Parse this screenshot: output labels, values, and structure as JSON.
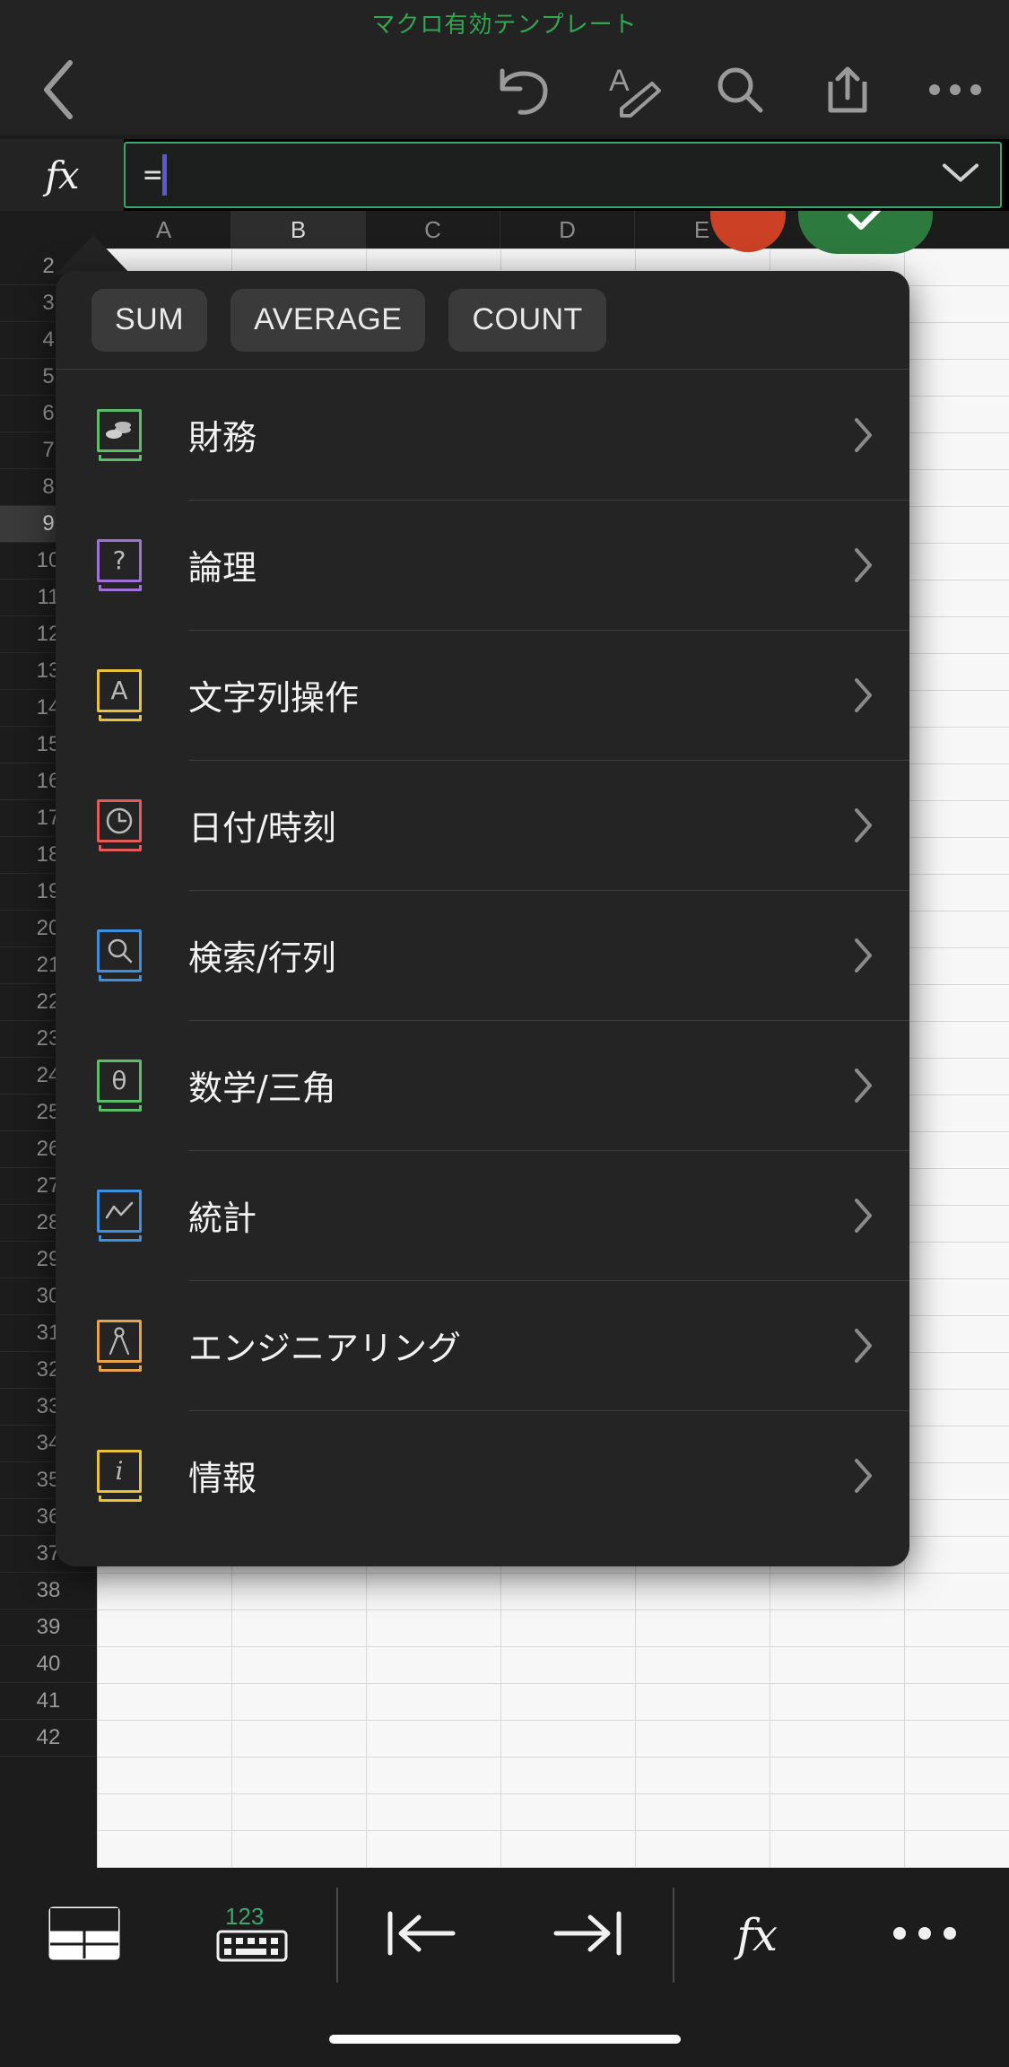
{
  "titlebar": {
    "doc_title": "マクロ有効テンプレート",
    "title_color": "#2fa84f"
  },
  "navbar": {
    "back_icon": "chevron-left-icon",
    "buttons": [
      {
        "name": "undo-button",
        "icon": "undo-icon"
      },
      {
        "name": "edit-text-button",
        "icon": "text-pen-icon"
      },
      {
        "name": "search-button",
        "icon": "search-icon"
      },
      {
        "name": "share-button",
        "icon": "share-icon"
      },
      {
        "name": "more-button",
        "icon": "ellipsis-icon"
      }
    ]
  },
  "formula_bar": {
    "fx_label": "fx",
    "value": "=",
    "placeholder": "",
    "expand_icon": "chevron-down-icon",
    "border_color": "#3aa76d",
    "caret_color": "#5a5ad6"
  },
  "sheet": {
    "columns": [
      "A",
      "B",
      "C",
      "D",
      "E"
    ],
    "selected_column": "B",
    "rows": [
      "2",
      "3",
      "4",
      "5",
      "6",
      "7",
      "8",
      "9",
      "10",
      "11",
      "12",
      "13",
      "14",
      "15",
      "16",
      "17",
      "18",
      "19",
      "20",
      "21",
      "22",
      "23",
      "24",
      "25",
      "26",
      "27",
      "28",
      "29",
      "30",
      "31",
      "32",
      "33",
      "34",
      "35",
      "36",
      "37",
      "38",
      "39",
      "40",
      "41",
      "42"
    ],
    "selected_row": "9",
    "cancel_button_color": "#cc4125",
    "confirm_button_color": "#2d7a3f",
    "confirm_icon": "checkmark-icon"
  },
  "function_picker": {
    "quick_functions": [
      "SUM",
      "AVERAGE",
      "COUNT"
    ],
    "categories": [
      {
        "label": "財務",
        "icon": "book-coins-icon",
        "color": "#5bbf6a",
        "symbol": "coins",
        "chevron": "chevron-right-icon"
      },
      {
        "label": "論理",
        "icon": "book-question-icon",
        "color": "#a071d6",
        "symbol": "?",
        "chevron": "chevron-right-icon"
      },
      {
        "label": "文字列操作",
        "icon": "book-letter-a-icon",
        "color": "#e8c23c",
        "symbol": "A",
        "chevron": "chevron-right-icon"
      },
      {
        "label": "日付/時刻",
        "icon": "book-clock-icon",
        "color": "#e35b5b",
        "symbol": "clock",
        "chevron": "chevron-right-icon"
      },
      {
        "label": "検索/行列",
        "icon": "book-search-icon",
        "color": "#3d8fe0",
        "symbol": "search",
        "chevron": "chevron-right-icon"
      },
      {
        "label": "数学/三角",
        "icon": "book-theta-icon",
        "color": "#5bbf6a",
        "symbol": "θ",
        "chevron": "chevron-right-icon"
      },
      {
        "label": "統計",
        "icon": "book-chart-icon",
        "color": "#3d8fe0",
        "symbol": "chart",
        "chevron": "chevron-right-icon"
      },
      {
        "label": "エンジニアリング",
        "icon": "book-compass-icon",
        "color": "#e8a24c",
        "symbol": "compass",
        "chevron": "chevron-right-icon"
      },
      {
        "label": "情報",
        "icon": "book-info-icon",
        "color": "#e8c23c",
        "symbol": "i",
        "chevron": "chevron-right-icon"
      }
    ]
  },
  "bottom_toolbar": {
    "items": [
      {
        "name": "sheet-view-button",
        "icon": "sheet-grid-icon",
        "label": ""
      },
      {
        "name": "numeric-keyboard-button",
        "icon": "keyboard-123-icon",
        "label": "123"
      },
      {
        "name": "move-left-button",
        "icon": "arrow-left-bar-icon",
        "label": ""
      },
      {
        "name": "move-right-button",
        "icon": "arrow-right-bar-icon",
        "label": ""
      },
      {
        "name": "formula-button",
        "icon": "fx-icon",
        "label": "fx"
      },
      {
        "name": "more-options-button",
        "icon": "ellipsis-icon",
        "label": ""
      }
    ]
  }
}
